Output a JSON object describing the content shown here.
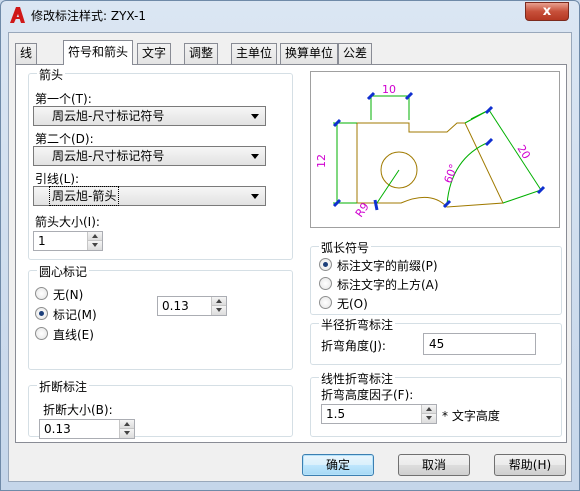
{
  "window": {
    "title": "修改标注样式: ZYX-1",
    "close_symbol": "x"
  },
  "tabs": [
    "线",
    "符号和箭头",
    "文字",
    "调整",
    "主单位",
    "换算单位",
    "公差"
  ],
  "active_tab": "符号和箭头",
  "arrows": {
    "group_title": "箭头",
    "first_label": "第一个(T):",
    "first_value": "周云旭-尺寸标记符号",
    "second_label": "第二个(D):",
    "second_value": "周云旭-尺寸标记符号",
    "leader_label": "引线(L):",
    "leader_value": "周云旭-箭头",
    "size_label": "箭头大小(I):",
    "size_value": "1"
  },
  "center_marks": {
    "group_title": "圆心标记",
    "options": [
      "无(N)",
      "标记(M)",
      "直线(E)"
    ],
    "selected": "标记(M)",
    "value": "0.13"
  },
  "break": {
    "group_title": "折断标注",
    "size_label": "折断大小(B):",
    "size_value": "0.13"
  },
  "preview": {
    "dim_top": "10",
    "dim_left": "12",
    "dim_right": "20",
    "dim_angle": "60°",
    "dim_radius": "R9"
  },
  "arc_length": {
    "group_title": "弧长符号",
    "options": [
      "标注文字的前缀(P)",
      "标注文字的上方(A)",
      "无(O)"
    ],
    "selected": "标注文字的前缀(P)"
  },
  "radius_jog": {
    "group_title": "半径折弯标注",
    "angle_label": "折弯角度(J):",
    "angle_value": "45"
  },
  "linear_jog": {
    "group_title": "线性折弯标注",
    "factor_label": "折弯高度因子(F):",
    "factor_value": "1.5",
    "suffix": "* 文字高度"
  },
  "buttons": {
    "ok": "确定",
    "cancel": "取消",
    "help": "帮助(H)"
  },
  "colors": {
    "accent_red": "#c7503a",
    "preview_part": "#a07a00",
    "preview_dim": "#00b000",
    "preview_text": "#d000d0",
    "preview_arrow": "#1030d0"
  }
}
